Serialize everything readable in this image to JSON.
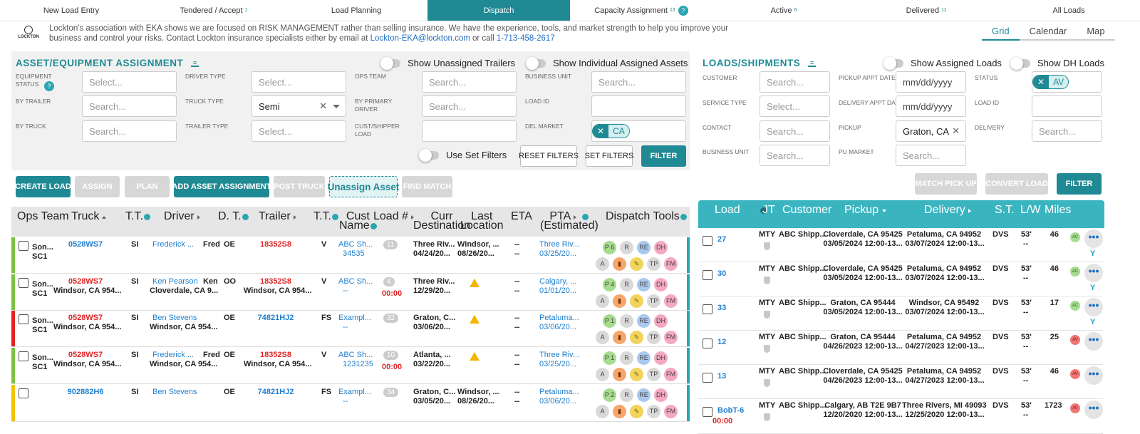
{
  "nav": {
    "tabs": [
      {
        "label": "New Load Entry",
        "count": ""
      },
      {
        "label": "Tendered / Accept",
        "count": "1"
      },
      {
        "label": "Load Planning",
        "count": ""
      },
      {
        "label": "Dispatch",
        "count": ""
      },
      {
        "label": "Capacity Assignment",
        "count": "13"
      },
      {
        "label": "Active",
        "count": "6"
      },
      {
        "label": "Delivered",
        "count": "11"
      },
      {
        "label": "All Loads",
        "count": ""
      }
    ],
    "help_glyph": "?"
  },
  "banner": {
    "logo_text": "LOCKTON",
    "text1": "Lockton's association with EKA shows we are focused on RISK MANAGEMENT rather than selling insurance. We have the experience, tools, and market strength to help you improve your business and control your risks. Contact Lockton insurance specialists either by email at ",
    "email": "Lockton-EKA@lockton.com",
    "text2": " or call ",
    "phone": "1-713-458-2617"
  },
  "view_tabs": [
    "Grid",
    "Calendar",
    "Map"
  ],
  "asset": {
    "title": "ASSET/EQUIPMENT ASSIGNMENT",
    "toggle_unassigned": "Show Unassigned Trailers",
    "toggle_individual": "Show Individual Assigned Assets",
    "labels": {
      "equipment_status": "EQUIPMENT STATUS",
      "driver_type": "DRIVER TYPE",
      "ops_team": "OPS TEAM",
      "business_unit": "BUSINESS UNIT",
      "by_trailer": "BY TRAILER",
      "truck_type": "TRUCK TYPE",
      "by_primary_driver": "BY PRIMARY DRIVER",
      "load_id": "LOAD ID",
      "by_truck": "BY TRUCK",
      "trailer_type": "TRAILER TYPE",
      "cust_shipper_load": "CUST/SHIPPER LOAD",
      "del_market": "DEL MARKET"
    },
    "placeholders": {
      "select": "Select...",
      "search": "Search..."
    },
    "truck_type_value": "Semi",
    "del_market_chip": "CA",
    "use_set_filters": "Use Set Filters",
    "reset_filters": "RESET FILTERS",
    "set_filters": "SET FILTERS",
    "filter": "FILTER",
    "actions": {
      "create_load": "CREATE LOAD",
      "assign": "ASSIGN",
      "plan": "PLAN",
      "add_asset_assignment": "ADD ASSET ASSIGNMENT",
      "post_truck": "POST TRUCK",
      "unassign_asset": "Unassign Asset",
      "find_match": "FIND MATCH"
    },
    "columns": {
      "ops_team": "Ops Team",
      "truck": "Truck",
      "tt": "T.T.",
      "driver": "Driver",
      "dt": "D. T.",
      "trailer": "Trailer",
      "tt2": "T.T.",
      "cust_name_1": "Cust",
      "cust_name_2": "Name",
      "load_no": "Load #",
      "curr_dest_1": "Curr",
      "curr_dest_2": "Destination",
      "last_loc_1": "Last",
      "last_loc_2": "Location",
      "eta": "ETA",
      "pta_1": "PTA",
      "pta_2": "(Estimated)",
      "dispatch_tools": "Dispatch Tools"
    },
    "rows": [
      {
        "bar": "#7cc242",
        "ops1": "Son...",
        "ops2": "SC1",
        "truck": "0528WS7",
        "truck_loc": "",
        "tt": "SI",
        "driver": "Frederick ...",
        "driver_alt": "Fred",
        "driver_loc": "",
        "dt": "OE",
        "trailer": "18352S8",
        "trailer_loc": "",
        "tt2": "V",
        "cust": "ABC Sh...",
        "cust2": "34535",
        "load": "11",
        "load_time": "",
        "curr1": "Three Riv...",
        "curr2": "04/24/20...",
        "last1": "Windsor, ...",
        "last2": "08/26/20...",
        "warn": false,
        "eta1": "--",
        "eta2": "--",
        "pta1": "Three Riv...",
        "pta2": "03/25/20...",
        "p": "P 6"
      },
      {
        "bar": "#7cc242",
        "ops1": "Son...",
        "ops2": "SC1",
        "truck": "0528WS7",
        "truck_loc": "Windsor, CA 954...",
        "tt": "SI",
        "driver": "Ken Pearson",
        "driver_alt": "Ken",
        "driver_loc": "Cloverdale, CA 9...",
        "dt": "OO",
        "trailer": "18352S8",
        "trailer_loc": "Windsor, CA 954...",
        "tt2": "V",
        "cust": "ABC Sh...",
        "cust2": "--",
        "load": "4",
        "load_time": "00:00",
        "curr1": "Three Riv...",
        "curr2": "12/29/20...",
        "last1": "",
        "last2": "",
        "warn": true,
        "eta1": "--",
        "eta2": "--",
        "pta1": "Calgary, ...",
        "pta2": "01/01/20...",
        "p": "P 4"
      },
      {
        "bar": "#e02424",
        "ops1": "Son...",
        "ops2": "SC1",
        "truck": "0528WS7",
        "truck_loc": "Windsor, CA 954...",
        "tt": "SI",
        "driver": "Ben Stevens",
        "driver_alt": "",
        "driver_loc": "Windsor, CA 954...",
        "dt": "OE",
        "trailer": "74821HJ2",
        "trailer_loc": "",
        "tt2": "FS",
        "cust": "Exampl...",
        "cust2": "--",
        "load": "32",
        "load_time": "",
        "curr1": "Graton, C...",
        "curr2": "03/06/20...",
        "last1": "",
        "last2": "",
        "warn": true,
        "eta1": "--",
        "eta2": "--",
        "pta1": "Petaluma...",
        "pta2": "03/06/20...",
        "p": "P 1"
      },
      {
        "bar": "#7cc242",
        "ops1": "Son...",
        "ops2": "SC1",
        "truck": "0528WS7",
        "truck_loc": "Windsor, CA 954...",
        "tt": "SI",
        "driver": "Frederick ...",
        "driver_alt": "Fred",
        "driver_loc": "Windsor, CA 954...",
        "dt": "OE",
        "trailer": "18352S8",
        "trailer_loc": "Windsor, CA 954...",
        "tt2": "V",
        "cust": "ABC Sh...",
        "cust2": "1231235",
        "load": "10",
        "load_time": "00:00",
        "curr1": "Atlanta, ...",
        "curr2": "03/22/20...",
        "last1": "",
        "last2": "",
        "warn": true,
        "eta1": "--",
        "eta2": "--",
        "pta1": "Three Riv...",
        "pta2": "03/25/20...",
        "p": "P 1"
      },
      {
        "bar": "#f2c200",
        "ops1": "",
        "ops2": "",
        "truck": "902882H6",
        "truck_loc": "",
        "tt": "SI",
        "driver": "Ben Stevens",
        "driver_alt": "",
        "driver_loc": "",
        "dt": "OE",
        "trailer": "74821HJ2",
        "trailer_loc": "",
        "tt2": "FS",
        "cust": "Exampl...",
        "cust2": "--",
        "load": "34",
        "load_time": "",
        "curr1": "Graton, C...",
        "curr2": "03/05/20...",
        "last1": "Windsor, ...",
        "last2": "08/26/20...",
        "warn": false,
        "eta1": "--",
        "eta2": "--",
        "pta1": "Petaluma...",
        "pta2": "03/06/20...",
        "p": "P 2"
      }
    ],
    "tools": [
      "R",
      "RE",
      "DH",
      "A",
      "TP",
      "FM"
    ]
  },
  "loads": {
    "title": "LOADS/SHIPMENTS",
    "toggle_assigned": "Show Assigned Loads",
    "toggle_dh": "Show DH Loads",
    "labels": {
      "customer": "CUSTOMER",
      "pickup_appt": "PICKUP APPT DATE",
      "status": "STATUS",
      "service_type": "SERVICE TYPE",
      "delivery_appt": "DELIVERY APPT DATE",
      "load_id": "LOAD ID",
      "contact": "CONTACT",
      "pickup": "PICKUP",
      "delivery": "DELIVERY",
      "business_unit": "BUSINESS UNIT",
      "pu_market": "PU MARKET"
    },
    "date_placeholder": "mm/dd/yyyy",
    "status_chip": "AV",
    "pickup_value": "Graton, CA",
    "match_pick_up": "MATCH PICK UP",
    "convert_load": "CONVERT LOAD",
    "filter": "FILTER",
    "columns": {
      "load": "Load",
      "jt": "JT",
      "customer": "Customer",
      "pickup": "Pickup",
      "delivery": "Delivery",
      "st": "S.T.",
      "lw": "L/W",
      "miles": "Miles"
    },
    "rows": [
      {
        "id": "27",
        "jt": "MTY",
        "customer": "ABC Shipp...",
        "pickup": "Cloverdale, CA 95425",
        "pickup_date": "03/05/2024 12:00-13...",
        "delivery": "Petaluma, CA 94952",
        "delivery_date": "03/07/2024 12:00-13...",
        "st": "DVS",
        "lw": "53'",
        "lw2": "--",
        "miles": "46",
        "status": "AC",
        "fork": true,
        "time": ""
      },
      {
        "id": "30",
        "jt": "MTY",
        "customer": "ABC Shipp...",
        "pickup": "Cloverdale, CA 95425",
        "pickup_date": "03/05/2024 12:00-13...",
        "delivery": "Petaluma, CA 94952",
        "delivery_date": "03/07/2024 12:00-13...",
        "st": "DVS",
        "lw": "53'",
        "lw2": "--",
        "miles": "46",
        "status": "AC",
        "fork": true,
        "time": ""
      },
      {
        "id": "33",
        "jt": "MTY",
        "customer": "ABC Shipp...",
        "pickup": "Graton, CA 95444",
        "pickup_date": "03/05/2024 12:00-13...",
        "delivery": "Windsor, CA 95492",
        "delivery_date": "03/07/2024 12:00-13...",
        "st": "DVS",
        "lw": "53'",
        "lw2": "--",
        "miles": "17",
        "status": "AC",
        "fork": true,
        "time": ""
      },
      {
        "id": "12",
        "jt": "MTY",
        "customer": "ABC Shipp...",
        "pickup": "Graton, CA 95444",
        "pickup_date": "04/26/2023 12:00-13...",
        "delivery": "Petaluma, CA 94952",
        "delivery_date": "04/27/2023 12:00-13...",
        "st": "DVS",
        "lw": "53'",
        "lw2": "--",
        "miles": "25",
        "status": "AV",
        "fork": false,
        "time": ""
      },
      {
        "id": "13",
        "jt": "MTY",
        "customer": "ABC Shipp...",
        "pickup": "Cloverdale, CA 95425",
        "pickup_date": "04/26/2023 12:00-13...",
        "delivery": "Petaluma, CA 94952",
        "delivery_date": "04/27/2023 12:00-13...",
        "st": "DVS",
        "lw": "53'",
        "lw2": "--",
        "miles": "46",
        "status": "AV",
        "fork": false,
        "time": ""
      },
      {
        "id": "BobT-6",
        "jt": "MTY",
        "customer": "ABC Shipp...",
        "pickup": "Calgary, AB T2E 9B7",
        "pickup_date": "12/20/2020 12:00-13...",
        "delivery": "Three Rivers, MI 49093",
        "delivery_date": "12/25/2020 12:00-13...",
        "st": "DVS",
        "lw": "53'",
        "lw2": "--",
        "miles": "1723",
        "status": "AV",
        "fork": false,
        "time": "00:00"
      }
    ],
    "more_glyph": "•••",
    "fork_glyph": "Y"
  },
  "colors": {
    "accent": "#1f8a94",
    "link": "#1f7fcf",
    "alert": "#e02424"
  }
}
